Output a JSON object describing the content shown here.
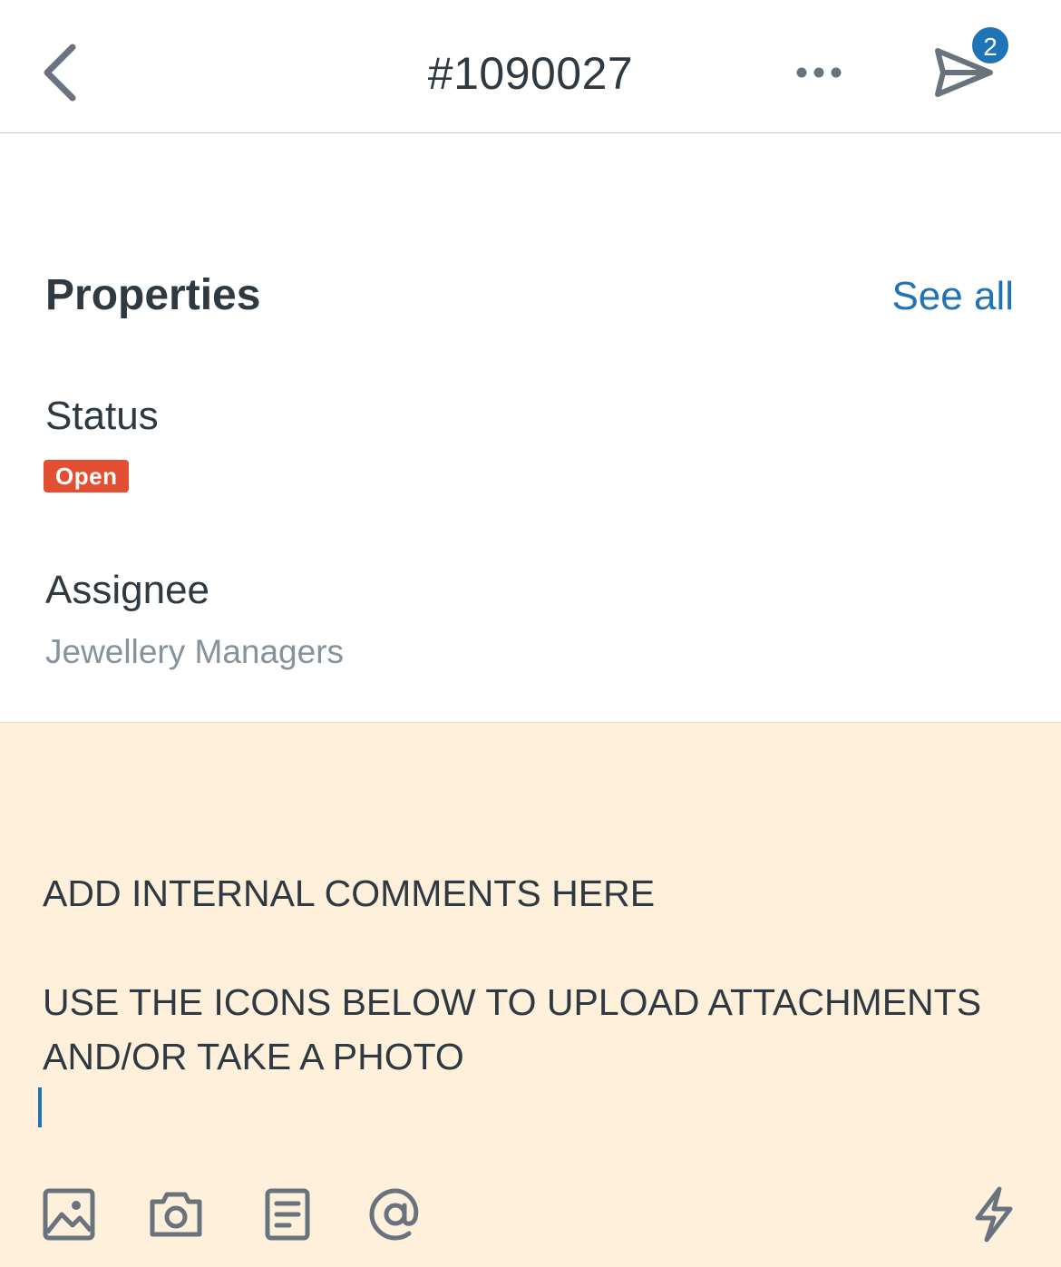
{
  "header": {
    "title": "#1090027",
    "back_icon": "chevron-left-icon",
    "more_icon": "ellipsis-icon",
    "send_icon": "send-icon",
    "send_badge_count": "2"
  },
  "properties": {
    "title": "Properties",
    "see_all_label": "See all",
    "status_label": "Status",
    "status_value": "Open",
    "assignee_label": "Assignee",
    "assignee_value": "Jewellery Managers"
  },
  "comment": {
    "text": "ADD INTERNAL COMMENTS HERE\n\nUSE THE ICONS BELOW TO UPLOAD ATTACHMENTS AND/OR TAKE A PHOTO"
  },
  "toolbar": {
    "icons": [
      "image-icon",
      "camera-icon",
      "document-icon",
      "mention-icon",
      "macro-bolt-icon"
    ]
  },
  "colors": {
    "accent": "#1f73b7",
    "status_open": "#e34f32",
    "comment_bg": "#fff0dc",
    "icon_gray": "#68737d",
    "text_dark": "#2f3941",
    "text_muted": "#87929d"
  }
}
